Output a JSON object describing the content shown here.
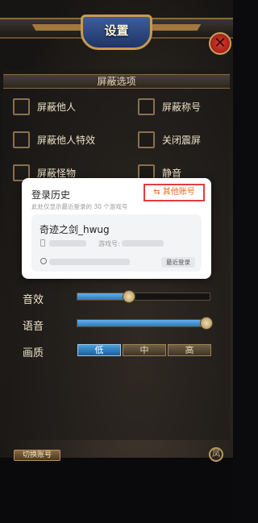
{
  "header": {
    "title": "设置"
  },
  "shield_section": {
    "title": "屏蔽选项",
    "options": [
      {
        "label": "屏蔽他人",
        "checked": false
      },
      {
        "label": "屏蔽称号",
        "checked": false
      },
      {
        "label": "屏蔽他人特效",
        "checked": false
      },
      {
        "label": "关闭震屏",
        "checked": false
      },
      {
        "label": "屏蔽怪物",
        "checked": false
      },
      {
        "label": "静音",
        "checked": false
      }
    ]
  },
  "audio": {
    "sound_label": "音效",
    "sound_level": 0.39,
    "voice_label": "语音",
    "voice_level": 1.0
  },
  "quality": {
    "label": "画质",
    "options": [
      "低",
      "中",
      "高"
    ],
    "selected": "低"
  },
  "footer": {
    "switch_account_label": "切换账号",
    "corner_icon_glyph": "凤"
  },
  "login_popup": {
    "title": "登录历史",
    "subtitle": "此处仅显示最近登录的 30 个游戏号",
    "other_account_label": "⇆ 其他账号",
    "account_name": "奇迹之剑_hwug",
    "game_id_label": "游戏号:",
    "recent_tag": "最近登录"
  },
  "colors": {
    "accent_orange": "#ef6a1f",
    "highlight_red": "#e53b3b",
    "slider_blue": "#2f78b8"
  }
}
